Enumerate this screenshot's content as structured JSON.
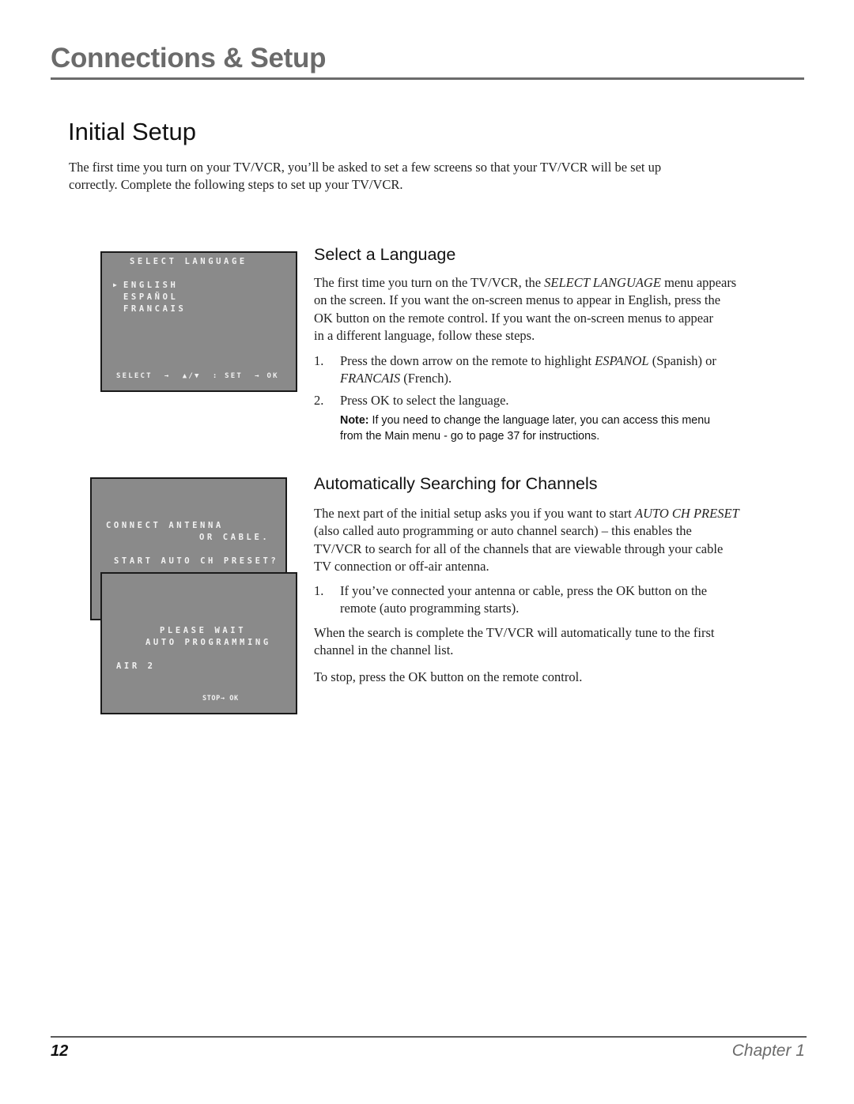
{
  "header": {
    "section_title": "Connections & Setup"
  },
  "page": {
    "title": "Initial Setup",
    "intro_line1": "The first time you turn on your TV/VCR, you’ll be asked to set a few screens so that your TV/VCR will be set up",
    "intro_line2": "correctly. Complete the following steps to set up your TV/VCR."
  },
  "select_language": {
    "heading": "Select a Language",
    "para_lines": [
      [
        "The first time you turn on the TV/VCR, the ",
        "SELECT LANGUAGE",
        " menu appears"
      ],
      "on the screen. If you want the on-screen menus to appear in English, press the",
      "OK button on the remote control.  If you want the on-screen menus to appear",
      "in a different language, follow these steps."
    ],
    "step1_num": "1.",
    "step1_pre": "Press the down arrow on the remote to highlight ",
    "step1_em1": "ESPANOL",
    "step1_mid": " (Spanish) or",
    "step1_em2": "FRANCAIS",
    "step1_post": " (French).",
    "step2_num": "2.",
    "step2_text": "Press OK to select the language.",
    "note_label": "Note:",
    "note_line1": " If you need to change the language later, you can access this menu",
    "note_line2": "from the Main menu - go to page 37 for instructions."
  },
  "auto_search": {
    "heading": "Automatically Searching for Channels",
    "para_pre": "The next part of the initial setup asks you if you want to start ",
    "para_em": "AUTO CH PRESET",
    "para_line2": "(also called auto programming or auto channel search) – this enables the",
    "para_line3": "TV/VCR to search for all of the channels that are viewable through your cable",
    "para_line4": "TV connection or off-air antenna.",
    "step1_num": "1.",
    "step1_line1": "If you’ve connected your antenna or cable, press the OK button on the",
    "step1_line2": "remote (auto programming starts).",
    "complete_line1": "When the search is complete the TV/VCR will automatically tune to the first",
    "complete_line2": "channel in the channel list.",
    "stop_text": "To stop, press the OK button on the remote control."
  },
  "tv_select_language": {
    "title": "SELECT LANGUAGE",
    "cursor_icon": "▶",
    "options": [
      "ENGLISH",
      "ESPAÑOL",
      "FRANCAIS"
    ],
    "selected": "ENGLISH",
    "footer": "SELECT  →  ▲/▼  : SET  → OK"
  },
  "tv_connect": {
    "line1": "CONNECT ANTENNA",
    "line2": "OR CABLE.",
    "line3": "START AUTO CH PRESET?"
  },
  "tv_auto_programming": {
    "line1": "PLEASE WAIT",
    "line2": "AUTO PROGRAMMING",
    "channel": "AIR 2",
    "footer": "STOP→ OK"
  },
  "footer": {
    "page_number": "12",
    "chapter": "Chapter 1"
  }
}
